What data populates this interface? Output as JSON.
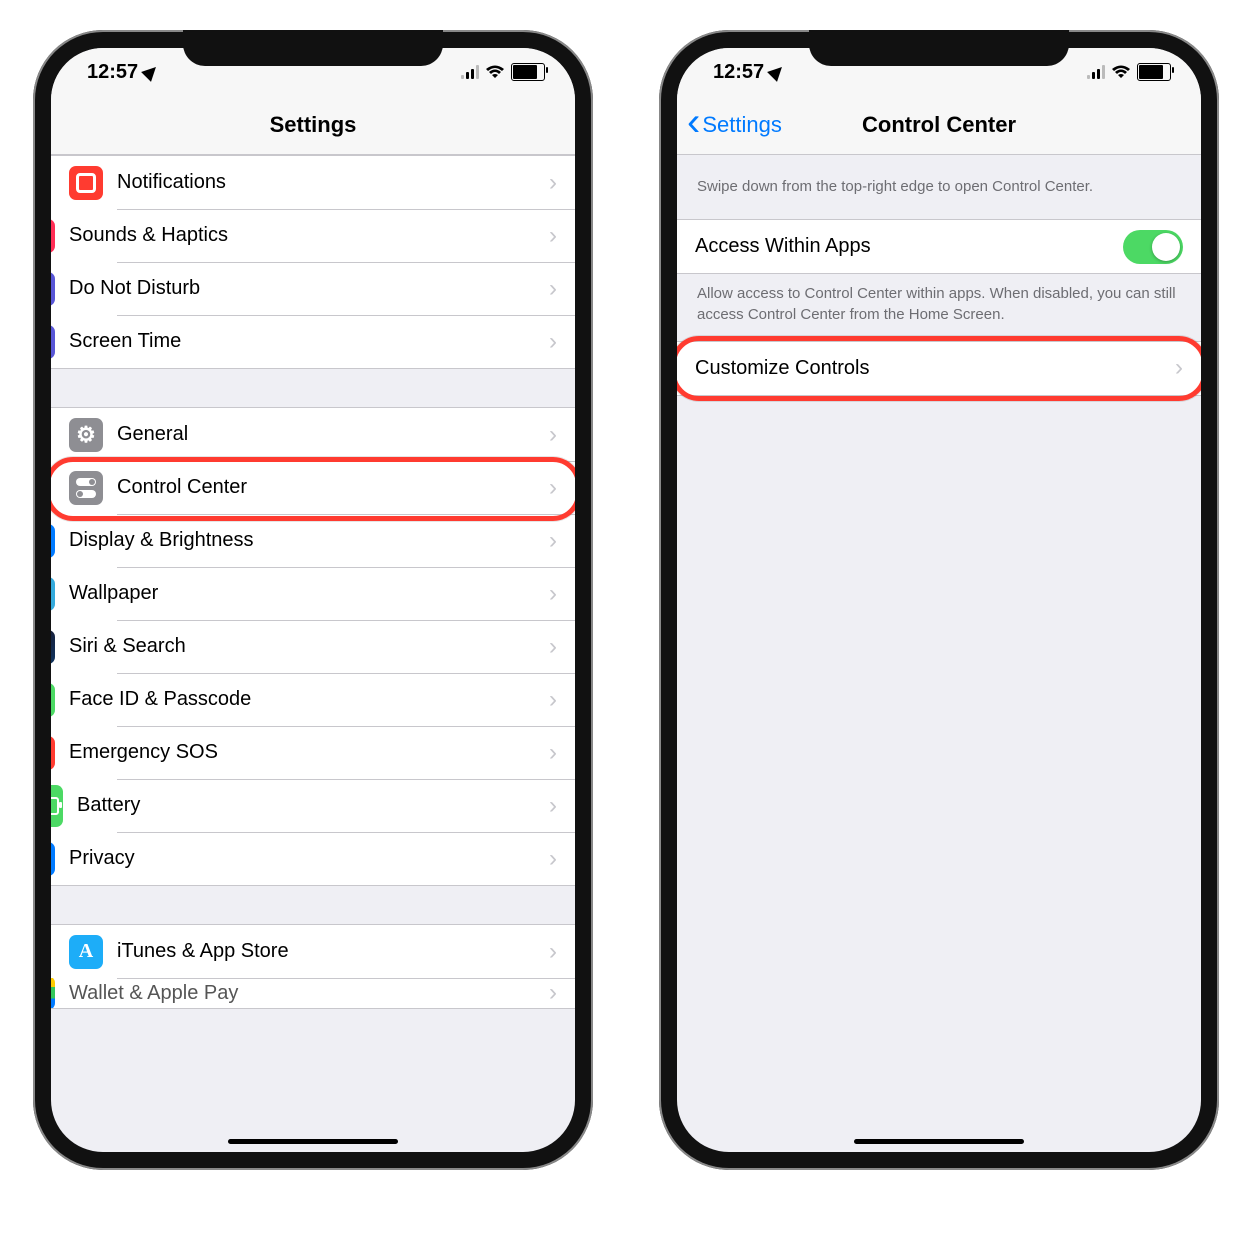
{
  "status": {
    "time": "12:57"
  },
  "left": {
    "title": "Settings",
    "group1": [
      {
        "icon": "notif",
        "color": "c-red",
        "label": "Notifications"
      },
      {
        "icon": "sound",
        "color": "c-pink",
        "label": "Sounds & Haptics"
      },
      {
        "icon": "moon",
        "color": "c-purple",
        "label": "Do Not Disturb"
      },
      {
        "icon": "hour",
        "color": "c-purple",
        "label": "Screen Time"
      }
    ],
    "group2": [
      {
        "icon": "gear",
        "color": "c-gray",
        "label": "General"
      },
      {
        "icon": "cc",
        "color": "c-gray",
        "label": "Control Center",
        "highlight": true
      },
      {
        "icon": "aa",
        "color": "c-blue",
        "label": "Display & Brightness"
      },
      {
        "icon": "flower",
        "color": "c-teal",
        "label": "Wallpaper"
      },
      {
        "icon": "siri",
        "color": "c-black",
        "label": "Siri & Search"
      },
      {
        "icon": "face",
        "color": "c-green",
        "label": "Face ID & Passcode"
      },
      {
        "icon": "sos",
        "color": "c-red",
        "label": "Emergency SOS"
      },
      {
        "icon": "bat",
        "color": "c-green",
        "label": "Battery"
      },
      {
        "icon": "hand",
        "color": "c-blue",
        "label": "Privacy"
      }
    ],
    "group3": [
      {
        "icon": "astore",
        "color": "c-ltblue",
        "label": "iTunes & App Store"
      },
      {
        "icon": "wallet",
        "color": "",
        "label": "Wallet & Apple Pay"
      }
    ]
  },
  "right": {
    "back": "Settings",
    "title": "Control Center",
    "hint": "Swipe down from the top-right edge to open Control Center.",
    "toggleRow": "Access Within Apps",
    "toggleOn": true,
    "toggleFooter": "Allow access to Control Center within apps. When disabled, you can still access Control Center from the Home Screen.",
    "customize": "Customize Controls"
  }
}
